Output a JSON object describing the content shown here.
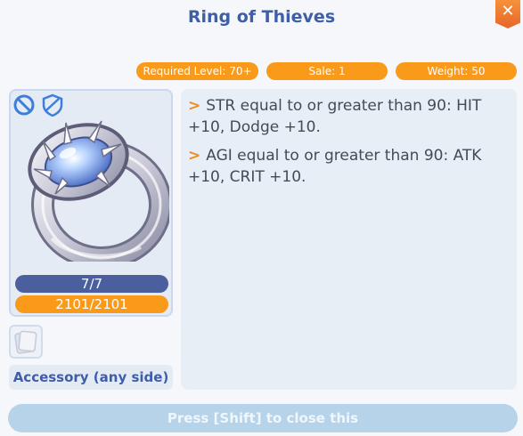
{
  "window": {
    "title": "Ring of Thieves",
    "close_icon": "close-icon"
  },
  "stats": {
    "required_level": "Required Level: 70+",
    "sale": "Sale: 1",
    "weight": "Weight: 50"
  },
  "item": {
    "icons": [
      "no-sell-icon",
      "no-trade-icon",
      "ring-icon"
    ],
    "refine": "7/7",
    "durability": "2101/2101",
    "slot": "Accessory (any side)"
  },
  "description": {
    "effects": [
      {
        "bullet": ">",
        "text": "STR equal to or greater than 90: HIT +10, Dodge +10."
      },
      {
        "bullet": ">",
        "text": "AGI equal to or greater than 90: ATK +10, CRIT +10."
      }
    ]
  },
  "footer": {
    "close_hint": "Press [Shift] to close this"
  },
  "colors": {
    "title": "#3f5ea8",
    "accent_orange": "#f99a1a",
    "refine_bar": "#4b5f9e",
    "panel_bg": "#e8eef6",
    "footer_button": "#b6d3ea"
  }
}
